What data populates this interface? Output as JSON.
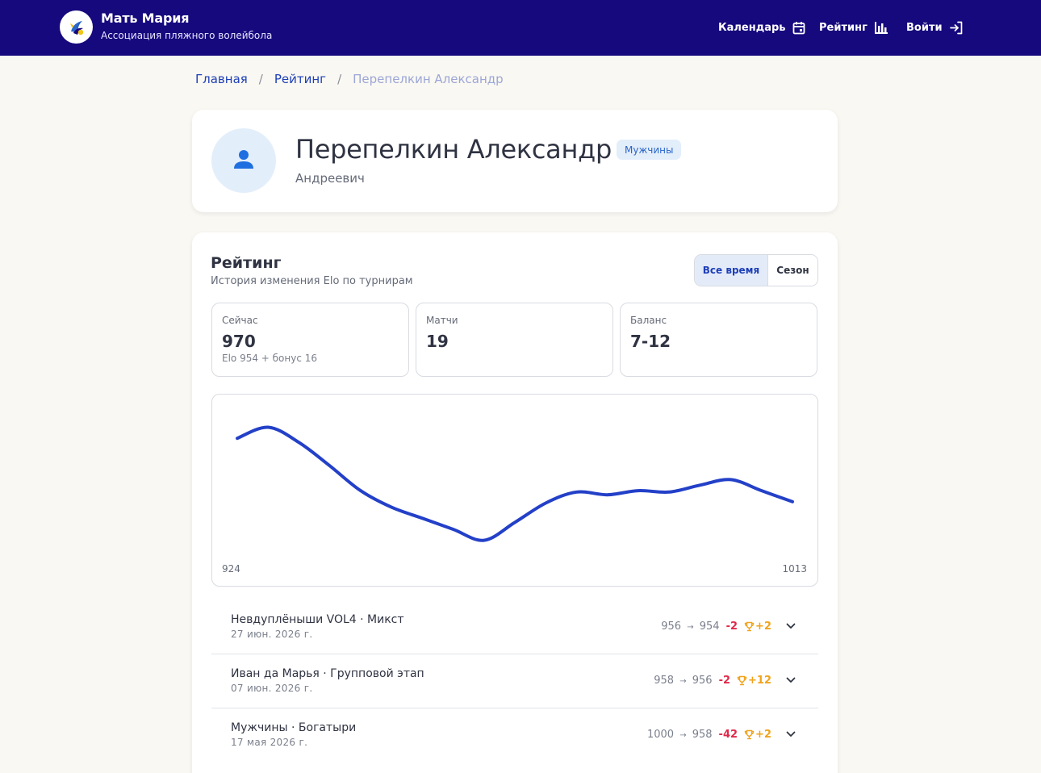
{
  "header": {
    "brand_title": "Мать Мария",
    "brand_subtitle": "Ассоциация пляжного волейбола",
    "logo_icon": "volleyball-bird-logo",
    "nav": {
      "calendar_label": "Календарь",
      "calendar_icon": "calendar-icon",
      "rating_label": "Рейтинг",
      "rating_icon": "bar-chart-icon",
      "login_label": "Войти",
      "login_icon": "login-arrow-icon"
    },
    "background_color": "#16087d"
  },
  "breadcrumb": {
    "home": "Главная",
    "rating": "Рейтинг",
    "current": "Перепелкин Александр",
    "separator": "/"
  },
  "profile": {
    "name": "Перепелкин Александр",
    "patronymic": "Андреевич",
    "category_badge": "Мужчины",
    "avatar_icon": "person-icon"
  },
  "rating": {
    "title": "Рейтинг",
    "subtitle": "История изменения Elo по турнирам",
    "toggle": {
      "all_time": "Все время",
      "season": "Сезон",
      "selected": "Все время"
    },
    "stats": [
      {
        "label": "Сейчас",
        "value": "970",
        "note": "Elo 954 + бонус 16"
      },
      {
        "label": "Матчи",
        "value": "19",
        "note": ""
      },
      {
        "label": "Баланс",
        "value": "7-12",
        "note": ""
      }
    ]
  },
  "chart_data": {
    "type": "line",
    "min_label": "924",
    "max_label": "1013",
    "series": [
      {
        "values": [
          1000,
          1008,
          997,
          980,
          962,
          950,
          942,
          934,
          926,
          939,
          953,
          961,
          959,
          962,
          961,
          966,
          970,
          962,
          954
        ]
      }
    ],
    "ylim": [
      924,
      1013
    ],
    "line_color": "#2340c8",
    "grid": false
  },
  "history": [
    {
      "title": "Невдуплёныши VOL4 · Микст",
      "date": "27 июн. 2026 г.",
      "from": "956",
      "arrow": "→",
      "to": "954",
      "delta": "-2",
      "bonus": "+2"
    },
    {
      "title": "Иван да Марья · Групповой этап",
      "date": "07 июн. 2026 г.",
      "from": "958",
      "arrow": "→",
      "to": "956",
      "delta": "-2",
      "bonus": "+12"
    },
    {
      "title": "Мужчины · Богатыри",
      "date": "17 мая 2026 г.",
      "from": "1000",
      "arrow": "→",
      "to": "958",
      "delta": "-42",
      "bonus": "+2"
    }
  ]
}
